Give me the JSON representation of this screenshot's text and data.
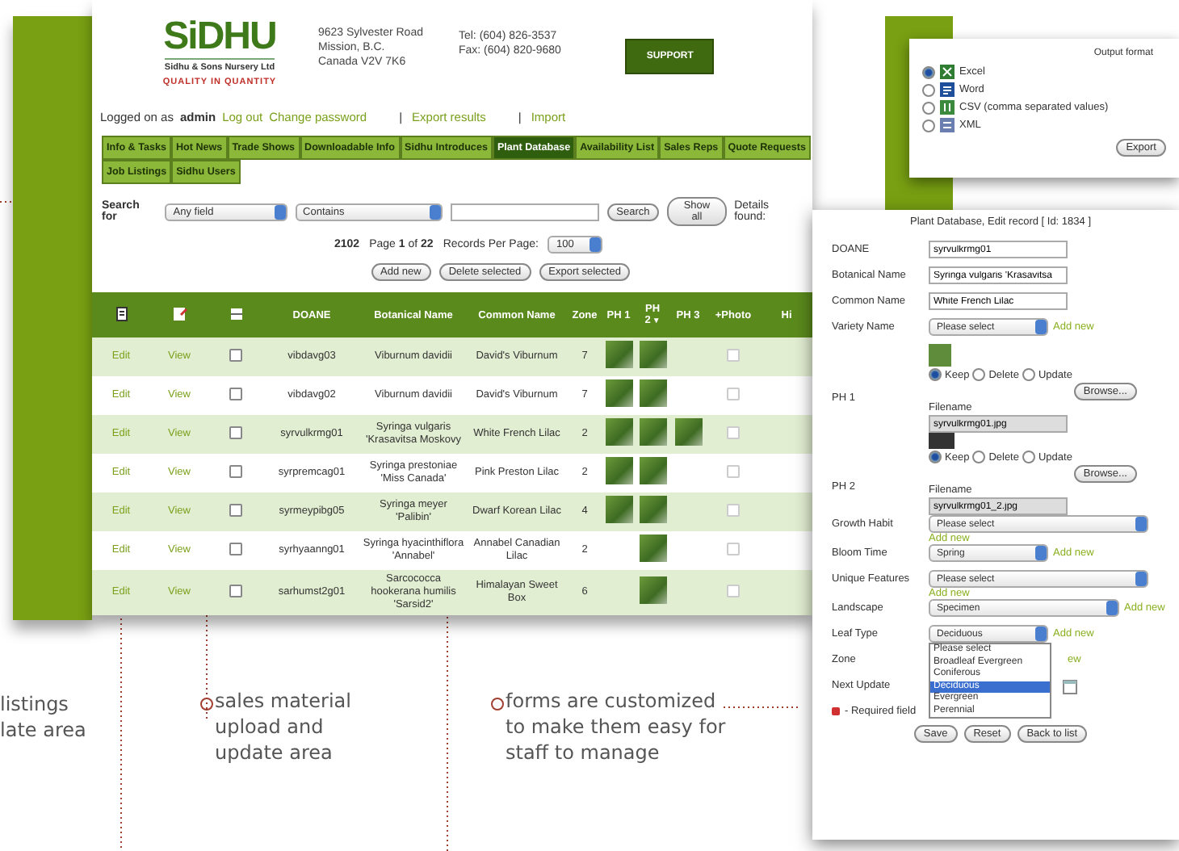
{
  "header": {
    "logo": "SiDHU",
    "company": "Sidhu & Sons Nursery Ltd",
    "tagline": "QUALITY IN QUANTITY",
    "address": [
      "9623 Sylvester Road",
      "Mission, B.C.",
      "Canada V2V 7K6"
    ],
    "phone": [
      "Tel: (604) 826-3537",
      "Fax: (604) 820-9680"
    ],
    "support_button": "SUPPORT"
  },
  "login": {
    "prefix": "Logged on as",
    "user": "admin",
    "links": [
      "Log out",
      "Change password"
    ],
    "actions": [
      "Export results",
      "Import"
    ],
    "separator": "|"
  },
  "nav_tabs": [
    {
      "label": "Info & Tasks",
      "selected": false
    },
    {
      "label": "Hot News",
      "selected": false
    },
    {
      "label": "Trade Shows",
      "selected": false
    },
    {
      "label": "Downloadable Info",
      "selected": false
    },
    {
      "label": "Sidhu Introduces",
      "selected": false
    },
    {
      "label": "Plant Database",
      "selected": true
    },
    {
      "label": "Availability List",
      "selected": false
    },
    {
      "label": "Sales Reps",
      "selected": false
    },
    {
      "label": "Quote Requests",
      "selected": false
    },
    {
      "label": "Job Listings",
      "selected": false
    },
    {
      "label": "Sidhu Users",
      "selected": false
    }
  ],
  "search": {
    "label": "Search for",
    "field_select": "Any field",
    "mode_select": "Contains",
    "buttons": [
      "Search",
      "Show all"
    ],
    "details": "Details found:"
  },
  "pager": {
    "count": "2102",
    "pages": "Page **1** of **22**",
    "per_page_label": "Records Per Page:",
    "per_page": "100"
  },
  "table_buttons": [
    "Add new",
    "Delete selected",
    "Export selected"
  ],
  "table": {
    "columns": [
      {
        "kind": "edit"
      },
      {
        "kind": "view"
      },
      {
        "kind": "check"
      },
      {
        "kind": "text",
        "label": "DOANE"
      },
      {
        "kind": "text",
        "label": "Botanical Name"
      },
      {
        "kind": "text",
        "label": "Common Name"
      },
      {
        "kind": "text",
        "label": "Zone"
      },
      {
        "kind": "text",
        "label": "PH 1"
      },
      {
        "kind": "text",
        "label": "PH 2",
        "sort_icon": "▼"
      },
      {
        "kind": "text",
        "label": "PH 3"
      },
      {
        "kind": "text",
        "label": "+Photo"
      },
      {
        "kind": "text",
        "label": "Hi"
      }
    ],
    "rows": [
      {
        "edit": "Edit",
        "view": "View",
        "selected": false,
        "doane": "vibdavg03",
        "botanical": "Viburnum davidii",
        "common": "David's Viburnum",
        "zone": "7",
        "photos": [
          true,
          true,
          false
        ],
        "plus_photo": false
      },
      {
        "edit": "Edit",
        "view": "View",
        "selected": false,
        "doane": "vibdavg02",
        "botanical": "Viburnum davidii",
        "common": "David's Viburnum",
        "zone": "7",
        "photos": [
          true,
          true,
          false
        ],
        "plus_photo": false
      },
      {
        "edit": "Edit",
        "view": "View",
        "selected": false,
        "doane": "syrvulkrmg01",
        "botanical": "Syringa vulgaris 'Krasavitsa Moskovy",
        "common": "White French Lilac",
        "zone": "2",
        "photos": [
          true,
          true,
          true
        ],
        "plus_photo": false
      },
      {
        "edit": "Edit",
        "view": "View",
        "selected": false,
        "doane": "syrpremcag01",
        "botanical": "Syringa prestoniae 'Miss Canada'",
        "common": "Pink Preston Lilac",
        "zone": "2",
        "photos": [
          true,
          true,
          false
        ],
        "plus_photo": false
      },
      {
        "edit": "Edit",
        "view": "View",
        "selected": false,
        "doane": "syrmeypibg05",
        "botanical": "Syringa meyer 'Palibin'",
        "common": "Dwarf Korean Lilac",
        "zone": "4",
        "photos": [
          true,
          true,
          false
        ],
        "plus_photo": false
      },
      {
        "edit": "Edit",
        "view": "View",
        "selected": false,
        "doane": "syrhyaanng01",
        "botanical": "Syringa hyacinthiflora 'Annabel'",
        "common": "Annabel Canadian Lilac",
        "zone": "2",
        "photos": [
          false,
          true,
          false
        ],
        "plus_photo": false
      },
      {
        "edit": "Edit",
        "view": "View",
        "selected": false,
        "doane": "sarhumst2g01",
        "botanical": "Sarcococca hookerana humilis 'Sarsid2'",
        "common": "Himalayan Sweet Box",
        "zone": "6",
        "photos": [
          false,
          true,
          false
        ],
        "plus_photo": false
      }
    ]
  },
  "export_popup": {
    "title": "Output format",
    "options": [
      {
        "kind": "excel",
        "label": "Excel",
        "selected": true
      },
      {
        "kind": "word",
        "label": "Word",
        "selected": false
      },
      {
        "kind": "csv",
        "label": "CSV (comma separated values)",
        "selected": false
      },
      {
        "kind": "xml",
        "label": "XML",
        "selected": false
      }
    ],
    "button": "Export"
  },
  "edit_form": {
    "title": "Plant Database, Edit record [ Id: 1834 ]",
    "fields": [
      {
        "kind": "text",
        "label": "DOANE",
        "value": "syrvulkrmg01"
      },
      {
        "kind": "text",
        "label": "Botanical Name",
        "value": "Syringa vulgaris 'Krasavitsa"
      },
      {
        "kind": "text",
        "label": "Common Name",
        "value": "White French Lilac"
      },
      {
        "kind": "select",
        "label": "Variety Name",
        "value": "Please select",
        "add": "Add new",
        "add_below": false
      },
      {
        "kind": "photo",
        "label": "PH 1",
        "radios": [
          {
            "label": "Keep",
            "selected": true
          },
          {
            "label": "Delete",
            "selected": false
          },
          {
            "label": "Update",
            "selected": false
          }
        ],
        "browse": "Browse...",
        "filename_label": "Filename",
        "filename": "syrvulkrmg01.jpg"
      },
      {
        "kind": "photo",
        "label": "PH 2",
        "radios": [
          {
            "label": "Keep",
            "selected": true
          },
          {
            "label": "Delete",
            "selected": false
          },
          {
            "label": "Update",
            "selected": false
          }
        ],
        "browse": "Browse...",
        "filename_label": "Filename",
        "filename": "syrvulkrmg01_2.jpg"
      },
      {
        "kind": "select",
        "label": "Growth Habit",
        "value": "Please select",
        "add": "Add new",
        "add_below": true
      },
      {
        "kind": "select",
        "label": "Bloom Time",
        "value": "Spring",
        "add": "Add new",
        "add_below": false
      },
      {
        "kind": "select",
        "label": "Unique Features",
        "value": "Please select",
        "add": "Add new",
        "add_below": true
      },
      {
        "kind": "select",
        "label": "Landscape",
        "value": "Specimen",
        "add": "Add new",
        "add_below": false
      },
      {
        "kind": "open_select",
        "label": "Leaf Type",
        "value": "Deciduous",
        "add": "Add new",
        "options": [
          {
            "label": "Please select",
            "selected": false
          },
          {
            "label": "Broadleaf Evergreen",
            "selected": false
          },
          {
            "label": "Coniferous",
            "selected": false
          },
          {
            "label": "Deciduous",
            "selected": true
          },
          {
            "label": "Evergreen",
            "selected": false
          },
          {
            "label": "Perennial",
            "selected": false
          }
        ]
      },
      {
        "kind": "covered",
        "label": "Zone",
        "tail": "ew"
      },
      {
        "kind": "date",
        "label": "Next Update"
      }
    ],
    "required_note": "- Required field",
    "buttons": [
      "Save",
      "Reset",
      "Back to list"
    ]
  },
  "annotations": [
    {
      "lines": [
        "listings",
        "late area"
      ],
      "marker": false
    },
    {
      "lines": [
        "sales material",
        "upload and",
        "update area"
      ],
      "marker": true
    },
    {
      "lines": [
        "forms are customized",
        "to make them easy for",
        "staff to manage"
      ],
      "marker": true
    }
  ]
}
